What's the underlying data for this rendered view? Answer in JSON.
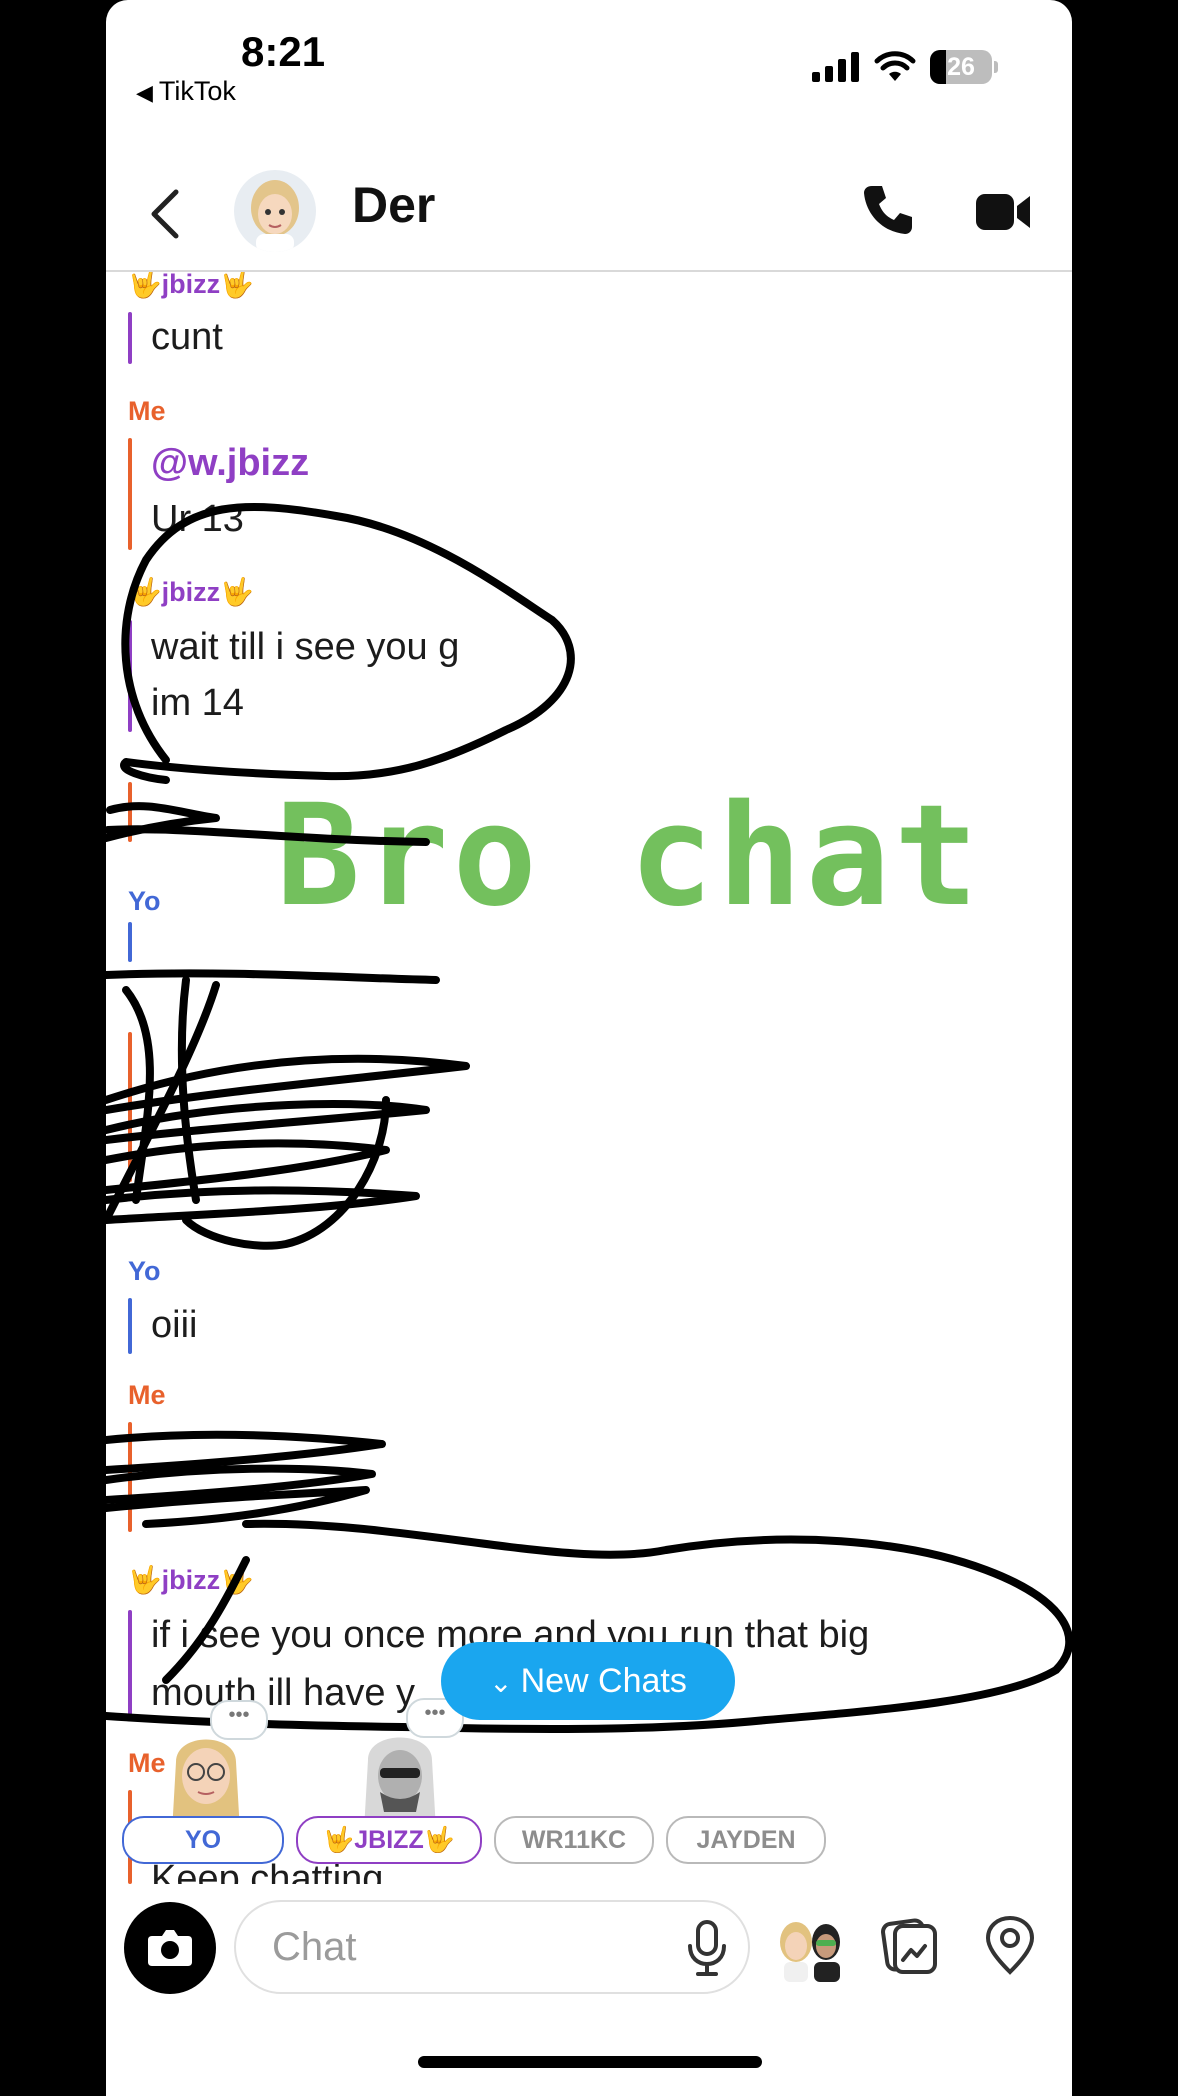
{
  "status_bar": {
    "time": "8:21",
    "back_app": "TikTok",
    "battery": "26",
    "icons": [
      "signal-icon",
      "wifi-icon",
      "battery-icon"
    ]
  },
  "header": {
    "name": "Der",
    "icons": [
      "back-chevron-icon",
      "avatar",
      "phone-icon",
      "video-icon"
    ]
  },
  "messages": [
    {
      "sender": "jbizz",
      "sender_prefix": "🤟",
      "sender_suffix": "🤟",
      "lines": [
        "cunt"
      ]
    },
    {
      "sender": "Me",
      "mention": "@w.jbizz",
      "lines": [
        "Ur 13"
      ]
    },
    {
      "sender": "jbizz",
      "sender_prefix": "🤟",
      "sender_suffix": "🤟",
      "lines": [
        "wait till i see you g",
        "im 14"
      ]
    },
    {
      "sender": "Yo",
      "lines": [
        "oiii"
      ]
    },
    {
      "sender": "Me",
      "lines": []
    },
    {
      "sender": "jbizz",
      "sender_prefix": "🤟",
      "sender_suffix": "🤟",
      "lines": [
        "if i see you once more and you run that big",
        "mouth ill have y"
      ]
    },
    {
      "sender": "Me",
      "lines": [
        "Keep chatting"
      ]
    }
  ],
  "labels": {
    "me": "Me",
    "yo": "Yo"
  },
  "overlay_text": "Bro chat",
  "new_chats_button": "New Chats",
  "typing_chips": [
    "YO",
    "🤟JBIZZ🤟",
    "WR11KC",
    "JAYDEN"
  ],
  "composer": {
    "placeholder": "Chat",
    "icons": [
      "camera-icon",
      "microphone-icon",
      "bitmoji-icon",
      "memories-icon",
      "map-pin-icon"
    ]
  },
  "colors": {
    "me": "#e8612c",
    "yo": "#4268d6",
    "jbizz": "#8f3fc4",
    "overlay": "#73c05d",
    "new_chats": "#1aa6ef"
  }
}
